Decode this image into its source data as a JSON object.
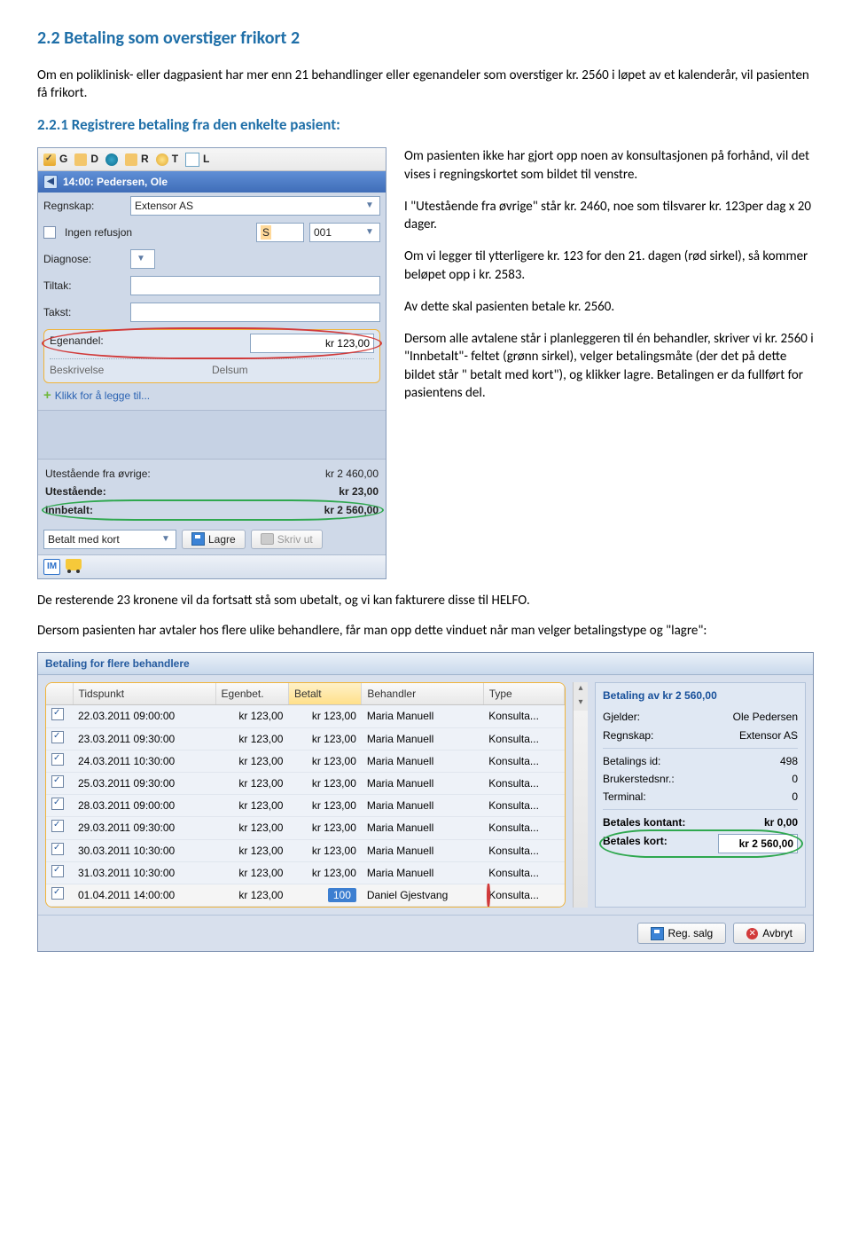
{
  "heading1": "2.2 Betaling som overstiger frikort 2",
  "intro": "Om en poliklinisk- eller dagpasient har mer enn 21 behandlinger eller egenandeler som overstiger kr. 2560 i løpet av et kalenderår, vil pasienten få frikort.",
  "heading2": "2.2.1 Registrere betaling fra den enkelte pasient:",
  "toolbar": {
    "g": "G",
    "d": "D",
    "dot": "",
    "r": "R",
    "t": "T",
    "l": "L"
  },
  "timehdr": "14:00: Pedersen, Ole",
  "form": {
    "regnskap_label": "Regnskap:",
    "regnskap_value": "Extensor AS",
    "refusjon_label": "Ingen refusjon",
    "code": "001",
    "diagnose": "Diagnose:",
    "tiltak": "Tiltak:",
    "takst": "Takst:",
    "egenandel": "Egenandel:",
    "egenandel_value": "kr 123,00",
    "beskrivelse": "Beskrivelse",
    "delsum": "Delsum"
  },
  "pluslink": "Klikk for å legge til...",
  "totals": {
    "ovrige_label": "Utestående fra øvrige:",
    "ovrige": "kr 2 460,00",
    "utest_label": "Utestående:",
    "utest": "kr 23,00",
    "innbetalt_label": "Innbetalt:",
    "innbetalt": "kr 2 560,00",
    "betaltmed": "Betalt med kort",
    "lagre": "Lagre",
    "skrivut": "Skriv ut"
  },
  "right": {
    "p1": "Om pasienten ikke har gjort opp noen av konsultasjonen på forhånd, vil det vises i regningskortet som bildet til venstre.",
    "p2": "I \"Utestående fra øvrige\" står kr. 2460, noe som tilsvarer kr. 123per dag x 20 dager.",
    "p3": "Om vi legger til ytterligere kr. 123 for den 21. dagen (rød sirkel), så kommer beløpet opp i kr. 2583.",
    "p4": "Av dette skal pasienten betale kr. 2560.",
    "p5": "Dersom alle avtalene står i planleggeren til én behandler, skriver vi kr. 2560 i \"Innbetalt\"- feltet (grønn sirkel), velger betalingsmåte (der det på dette bildet står \" betalt med kort\"), og klikker lagre. Betalingen er da fullført for pasientens del."
  },
  "after1": "De resterende 23 kronene vil da fortsatt stå som ubetalt, og vi kan fakturere disse til HELFO.",
  "after2": "Dersom pasienten har avtaler hos flere ulike behandlere, får man opp dette vinduet når man velger betalingstype og \"lagre\":",
  "dialog": {
    "title": "Betaling for flere behandlere",
    "cols": {
      "tidspunkt": "Tidspunkt",
      "egenbet": "Egenbet.",
      "betalt": "Betalt",
      "behandler": "Behandler",
      "type": "Type"
    },
    "rows": [
      {
        "t": "22.03.2011 09:00:00",
        "e": "kr 123,00",
        "b": "kr 123,00",
        "beh": "Maria Manuell",
        "ty": "Konsulta..."
      },
      {
        "t": "23.03.2011 09:30:00",
        "e": "kr 123,00",
        "b": "kr 123,00",
        "beh": "Maria Manuell",
        "ty": "Konsulta..."
      },
      {
        "t": "24.03.2011 10:30:00",
        "e": "kr 123,00",
        "b": "kr 123,00",
        "beh": "Maria Manuell",
        "ty": "Konsulta..."
      },
      {
        "t": "25.03.2011 09:30:00",
        "e": "kr 123,00",
        "b": "kr 123,00",
        "beh": "Maria Manuell",
        "ty": "Konsulta..."
      },
      {
        "t": "28.03.2011 09:00:00",
        "e": "kr 123,00",
        "b": "kr 123,00",
        "beh": "Maria Manuell",
        "ty": "Konsulta..."
      },
      {
        "t": "29.03.2011 09:30:00",
        "e": "kr 123,00",
        "b": "kr 123,00",
        "beh": "Maria Manuell",
        "ty": "Konsulta..."
      },
      {
        "t": "30.03.2011 10:30:00",
        "e": "kr 123,00",
        "b": "kr 123,00",
        "beh": "Maria Manuell",
        "ty": "Konsulta..."
      },
      {
        "t": "31.03.2011 10:30:00",
        "e": "kr 123,00",
        "b": "kr 123,00",
        "beh": "Maria Manuell",
        "ty": "Konsulta..."
      }
    ],
    "lastrow": {
      "t": "01.04.2011 14:00:00",
      "e": "kr 123,00",
      "b": "100",
      "beh": "Daniel Gjestvang",
      "ty": "Konsulta..."
    },
    "side": {
      "hdr": "Betaling av kr 2 560,00",
      "gjelder_l": "Gjelder:",
      "gjelder": "Ole Pedersen",
      "regnskap_l": "Regnskap:",
      "regnskap": "Extensor AS",
      "betid_l": "Betalings id:",
      "betid": "498",
      "bruker_l": "Brukerstedsnr.:",
      "bruker": "0",
      "term_l": "Terminal:",
      "term": "0",
      "kontant_l": "Betales kontant:",
      "kontant": "kr 0,00",
      "kort_l": "Betales kort:",
      "kort": "kr 2 560,00"
    },
    "btn_reg": "Reg. salg",
    "btn_avbryt": "Avbryt"
  }
}
